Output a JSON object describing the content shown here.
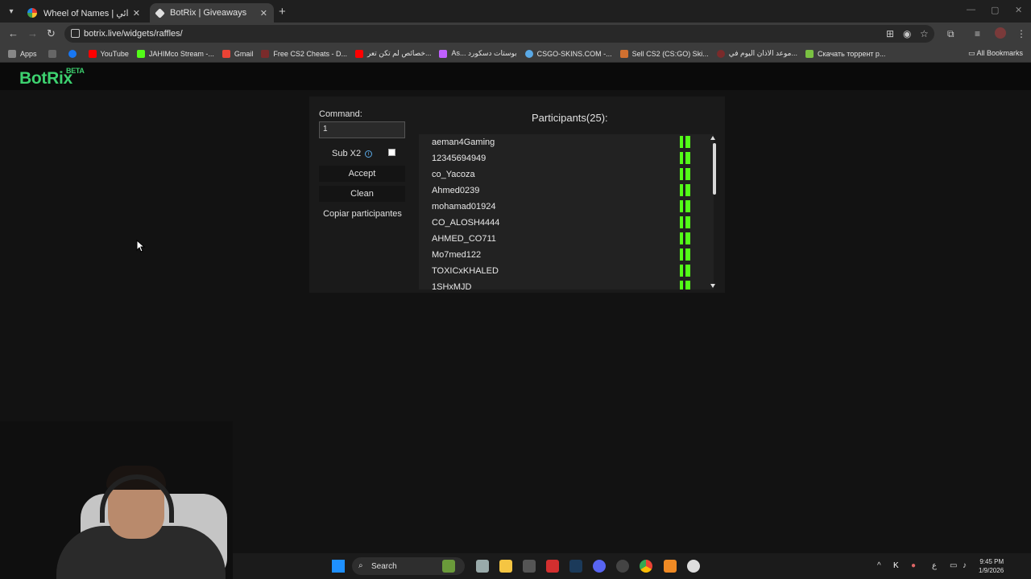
{
  "browser": {
    "tabs": [
      {
        "title": "Wheel of Names | اسم العشوائي",
        "active": false
      },
      {
        "title": "BotRix | Giveaways",
        "active": true
      }
    ],
    "url": "botrix.live/widgets/raffles/",
    "bookmarks": [
      {
        "label": "Apps",
        "color": "#e3e3e3"
      },
      {
        "label": "YouTube",
        "color": "#ff0000"
      },
      {
        "label": "JAHIMco Stream -...",
        "color": "#53fc18"
      },
      {
        "label": "Gmail",
        "color": "#ea4335"
      },
      {
        "label": "Free CS2 Cheats - D...",
        "color": "#7a2b2b"
      },
      {
        "label": "خصائص لم تكن تعر...",
        "color": "#ff0000"
      },
      {
        "label": "As... بوستات دسكورد",
        "color": "#c060ff"
      },
      {
        "label": "CSGO-SKINS.COM -...",
        "color": "#5aa9e6"
      },
      {
        "label": "Sell CS2 (CS:GO) Ski...",
        "color": "#d07030"
      },
      {
        "label": "موعد الاذان اليوم في...",
        "color": "#7a2b2b"
      },
      {
        "label": "Скачать торрент р...",
        "color": "#7ac142"
      }
    ],
    "all_bookmarks": "All Bookmarks"
  },
  "site": {
    "brand": "BotRix",
    "brand_badge": "BETA"
  },
  "raffle": {
    "command_label": "Command:",
    "command_value": "1",
    "sub_label": "Sub X2",
    "sub_checked": false,
    "accept_label": "Accept",
    "clean_label": "Clean",
    "copy_label": "Copiar participantes",
    "participants_title": "Participants(25):",
    "participants": [
      "aeman4Gaming",
      "12345694949",
      "co_Yacoza",
      "Ahmed0239",
      "mohamad01924",
      "CO_ALOSH4444",
      "AHMED_CO711",
      "Mo7med122",
      "TOXICxKHALED",
      "1SHxMJD"
    ]
  },
  "taskbar": {
    "search_label": "Search",
    "time": "9:45 PM",
    "date": "1/9/2026",
    "lang": "ع"
  }
}
